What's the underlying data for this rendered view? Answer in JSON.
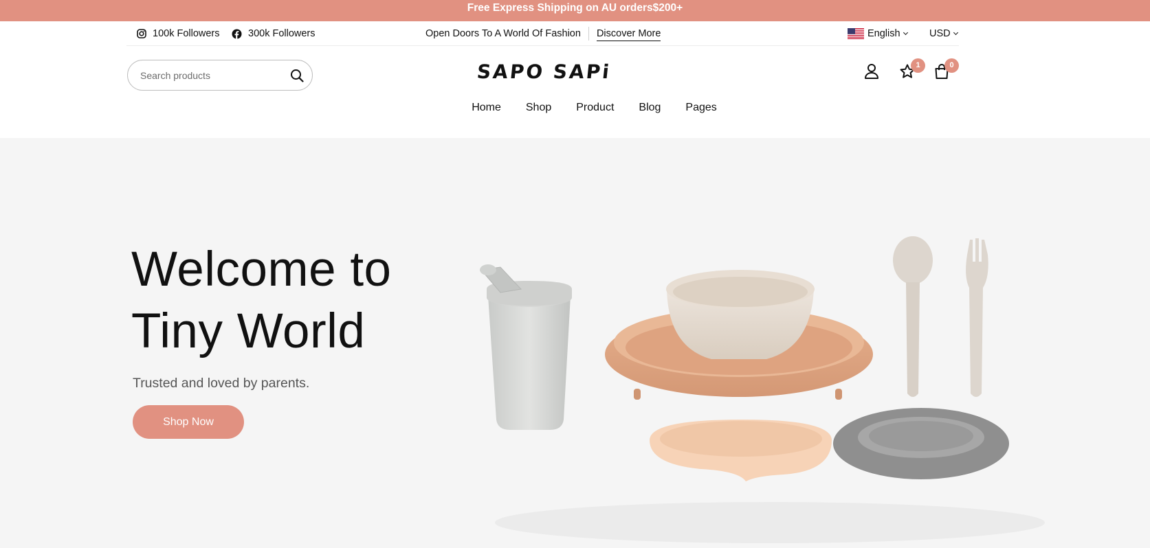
{
  "promo": {
    "text": "Free Express Shipping on AU orders$200+"
  },
  "topbar": {
    "instagram": {
      "label": "100k Followers",
      "icon": "instagram-icon"
    },
    "facebook": {
      "label": "300k Followers",
      "icon": "facebook-icon"
    },
    "tagline": "Open Doors To A World Of Fashion",
    "discover": "Discover More",
    "language": "English",
    "currency": "USD"
  },
  "header": {
    "search_placeholder": "Search products",
    "logo": "SAPO SAPi",
    "wishlist_count": "1",
    "cart_count": "0"
  },
  "nav": {
    "items": [
      "Home",
      "Shop",
      "Product",
      "Blog",
      "Pages"
    ]
  },
  "hero": {
    "title_line1": "Welcome to",
    "title_line2": "Tiny World",
    "subtitle": "Trusted and loved by parents.",
    "cta": "Shop Now"
  },
  "colors": {
    "accent": "#e19181",
    "hero_bg": "#f5f5f5"
  }
}
